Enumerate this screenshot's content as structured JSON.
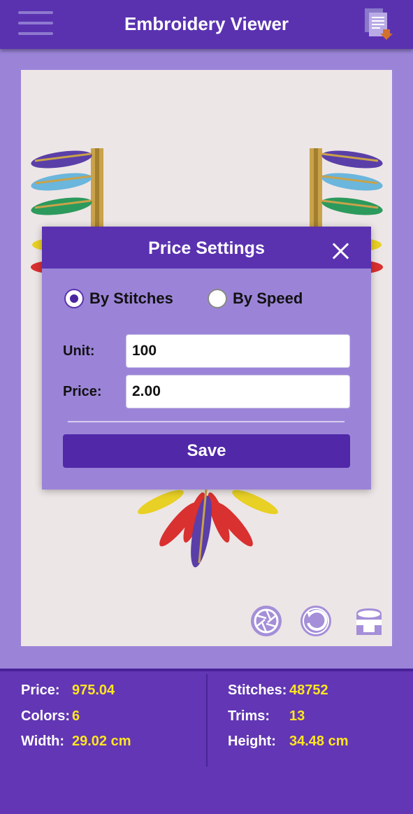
{
  "header": {
    "title": "Embroidery Viewer",
    "menu_icon": "hamburger-menu-icon",
    "file_icon": "file-export-icon"
  },
  "toolbar": {
    "icons": [
      "aperture-icon",
      "rotate-icon",
      "paint-bucket-icon"
    ]
  },
  "dialog": {
    "title": "Price Settings",
    "close_icon": "close-icon",
    "options": [
      {
        "label": "By Stitches",
        "selected": true
      },
      {
        "label": "By Speed",
        "selected": false
      }
    ],
    "unit_label": "Unit:",
    "unit_value": "100",
    "price_label": "Price:",
    "price_value": "2.00",
    "save_label": "Save"
  },
  "info": {
    "price_label": "Price:",
    "price_value": "975.04",
    "colors_label": "Colors:",
    "colors_value": "6",
    "width_label": "Width:",
    "width_value": "29.02 cm",
    "stitches_label": "Stitches:",
    "stitches_value": "48752",
    "trims_label": "Trims:",
    "trims_value": "13",
    "height_label": "Height:",
    "height_value": "34.48 cm"
  },
  "colors": {
    "primary": "#5a32b0",
    "background": "#9b84d8",
    "accent_value": "#ffe521",
    "canvas": "#ede6e6"
  }
}
